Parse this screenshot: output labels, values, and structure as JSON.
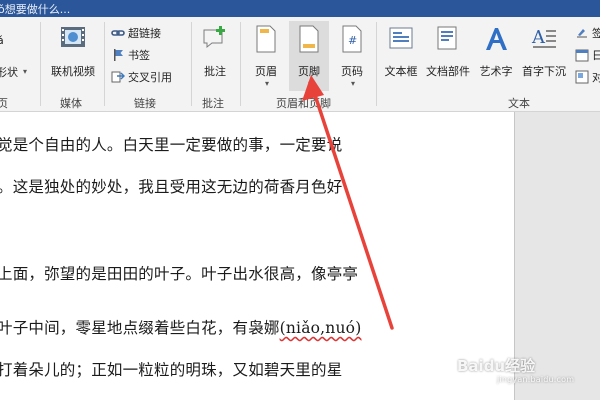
{
  "titlebar": {
    "search_hint": "ǒ想要做什么..."
  },
  "ribbon": {
    "partial_left_top": "ǎ",
    "partial_left_mid": "形状",
    "partial_left_group": "页",
    "media": {
      "online_video_label": "联机视频",
      "group_label": "媒体"
    },
    "links": {
      "hyperlink_label": "超链接",
      "bookmark_label": "书签",
      "cross_ref_label": "交叉引用",
      "group_label": "链接"
    },
    "comments": {
      "comment_label": "批注",
      "group_label": "批注"
    },
    "header_footer": {
      "header_label": "页眉",
      "footer_label": "页脚",
      "page_number_label": "页码",
      "group_label": "页眉和页脚"
    },
    "text": {
      "textbox_label": "文本框",
      "quickparts_label": "文档部件",
      "wordart_label": "艺术字",
      "dropcap_label": "首字下沉",
      "group_label": "文本"
    },
    "right_partial": {
      "item1": "签",
      "item2": "日",
      "item3": "对"
    }
  },
  "document": {
    "lines": [
      "觉是个自由的人。白天里一定要做的事，一定要说",
      "。这是独处的妙处，我且受用这无边的荷香月色好",
      "上面，弥望的是田田的叶子。叶子出水很高，像亭亭",
      "叶子中间，零星地点缀着些白花，有袅娜",
      "打着朵儿的；正如一粒粒的明珠，又如碧天里的星"
    ],
    "pinyin_word": "(niǎo,nuó)"
  },
  "watermark": {
    "text": "Baidu经验",
    "sub": "jingyan.baidu.com"
  },
  "colors": {
    "titlebar": "#2b579a",
    "arrow": "#e8433a",
    "ribbon": "#f3f3f3"
  }
}
